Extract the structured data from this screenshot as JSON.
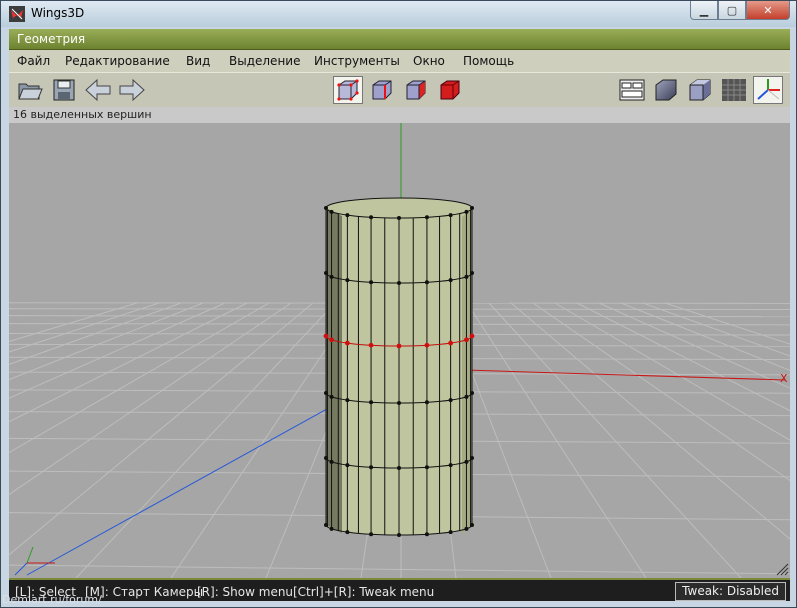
{
  "window": {
    "title": "Wings3D"
  },
  "geometry_bar": {
    "title": "Геометрия"
  },
  "menu": {
    "items": [
      {
        "label": "Файл"
      },
      {
        "label": "Редактирование"
      },
      {
        "label": "Вид"
      },
      {
        "label": "Выделение"
      },
      {
        "label": "Инструменты"
      },
      {
        "label": "Окно"
      },
      {
        "label": "Помощь"
      }
    ]
  },
  "toolbar": {
    "left_icons": [
      "open-folder-icon",
      "save-icon",
      "undo-arrow-icon",
      "redo-arrow-icon"
    ],
    "select_modes": [
      "vertex-mode-icon",
      "edge-mode-icon",
      "face-mode-icon",
      "body-mode-icon"
    ],
    "active_select_mode": "vertex-mode-icon",
    "right_icons": [
      "workmode-icon",
      "smooth-shaded-icon",
      "flat-shaded-icon",
      "ground-grid-icon",
      "axes-icon"
    ]
  },
  "info": {
    "text": "16 выделенных вершин"
  },
  "status": {
    "items": [
      {
        "text": "[L]: Select"
      },
      {
        "text": "[M]: Старт Камеры"
      },
      {
        "text": "[R]: Show menu"
      },
      {
        "text": "[Ctrl]+[R]: Tweak menu"
      }
    ],
    "tweak": "Tweak: Disabled"
  },
  "viewport": {
    "axis_x_label": "X",
    "colors": {
      "axis_x": "#cc1818",
      "axis_y": "#2e9a20",
      "axis_z": "#2458d8",
      "selected_vertex": "#d01010",
      "mesh": "#bfc59e"
    }
  },
  "watermark": "Demiart.ru/forum/"
}
